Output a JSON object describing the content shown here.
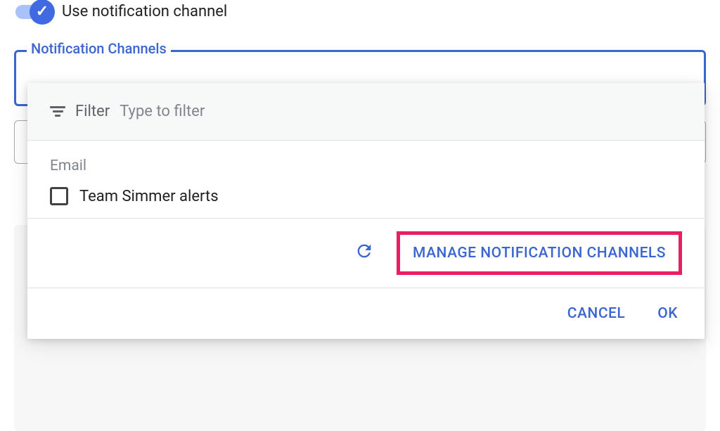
{
  "toggle": {
    "label": "Use notification channel",
    "checked": true
  },
  "fieldset": {
    "legend": "Notification Channels"
  },
  "dropdown": {
    "filter": {
      "label": "Filter",
      "placeholder": "Type to filter"
    },
    "sections": [
      {
        "type_label": "Email",
        "items": [
          {
            "name": "Team Simmer alerts",
            "checked": false
          }
        ]
      }
    ],
    "manage_button": "MANAGE NOTIFICATION CHANNELS",
    "actions": {
      "cancel": "CANCEL",
      "ok": "OK"
    }
  }
}
